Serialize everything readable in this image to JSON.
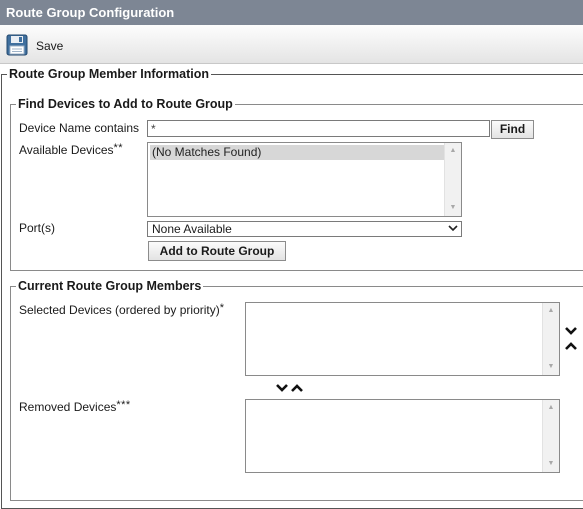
{
  "window": {
    "title": "Route Group Configuration"
  },
  "toolbar": {
    "save_label": "Save",
    "save_icon": "floppy-disk-icon"
  },
  "member_info": {
    "legend": "Route Group Member Information"
  },
  "find_devices": {
    "legend": "Find Devices to Add to Route Group",
    "device_name_label": "Device Name contains",
    "device_name_value": "*",
    "find_button": "Find",
    "available_label": "Available Devices",
    "available_marker": "**",
    "available_items": [
      "(No Matches Found)"
    ],
    "ports_label": "Port(s)",
    "ports_selected": "None Available",
    "add_button": "Add to Route Group"
  },
  "current_members": {
    "legend": "Current Route Group Members",
    "selected_label": "Selected Devices (ordered by priority)",
    "selected_marker": "*",
    "removed_label": "Removed Devices",
    "removed_marker": "***"
  },
  "icons": {
    "move_down": "chevron-down-icon",
    "move_up": "chevron-up-icon"
  },
  "colors": {
    "title_bar": "#7d8694",
    "selected_item_bg": "#d7d7d7"
  }
}
